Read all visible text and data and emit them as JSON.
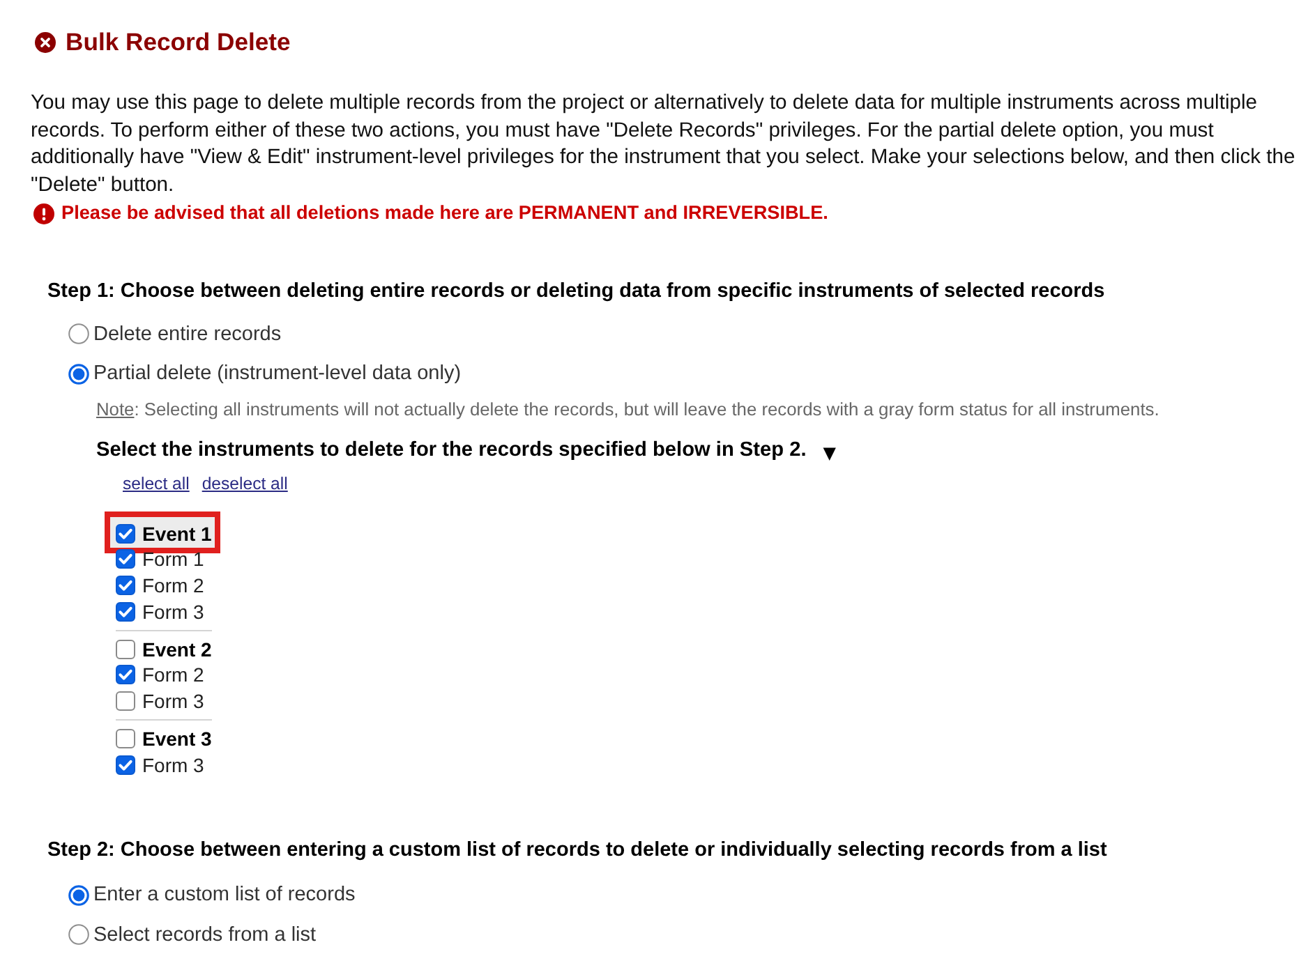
{
  "header": {
    "title": "Bulk Record Delete",
    "intro": "You may use this page to delete multiple records from the project or alternatively to delete data for multiple instruments across multiple records. To perform either of these two actions, you must have \"Delete Records\" privileges. For the partial delete option, you must additionally have \"View & Edit\" instrument-level privileges for the instrument that you select. Make your selections below, and then click the \"Delete\" button.",
    "warning": "Please be advised that all deletions made here are PERMANENT and IRREVERSIBLE."
  },
  "step_1": {
    "heading": "Step 1: Choose between deleting entire records or deleting data from specific instruments of selected records",
    "options": [
      {
        "label": "Delete entire records",
        "selected": false
      },
      {
        "label": "Partial delete (instrument-level data only)",
        "selected": true
      }
    ],
    "note": {
      "label": "Note",
      "text": ": Selecting all instruments will not actually delete the records, but will leave the records with a gray form status for all instruments."
    },
    "instruments": {
      "heading": "Select the instruments to delete for the records specified below in Step 2.",
      "toggle": "▼",
      "links": [
        "select all",
        "deselect all"
      ],
      "events": [
        {
          "label": "Event 1",
          "checked": true,
          "highlighted": true,
          "forms": [
            {
              "label": "Form 1",
              "checked": true
            },
            {
              "label": "Form 2",
              "checked": true
            },
            {
              "label": "Form 3",
              "checked": true
            }
          ]
        },
        {
          "label": "Event 2",
          "checked": false,
          "highlighted": false,
          "forms": [
            {
              "label": "Form 2",
              "checked": true
            },
            {
              "label": "Form 3",
              "checked": false
            }
          ]
        },
        {
          "label": "Event 3",
          "checked": false,
          "highlighted": false,
          "forms": [
            {
              "label": "Form 3",
              "checked": true
            }
          ]
        }
      ]
    }
  },
  "step_2": {
    "heading": "Step 2: Choose between entering a custom list of records to delete or individually selecting records from a list",
    "options": [
      {
        "label": "Enter a custom list of records",
        "selected": true
      },
      {
        "label": "Select records from a list",
        "selected": false
      }
    ]
  }
}
